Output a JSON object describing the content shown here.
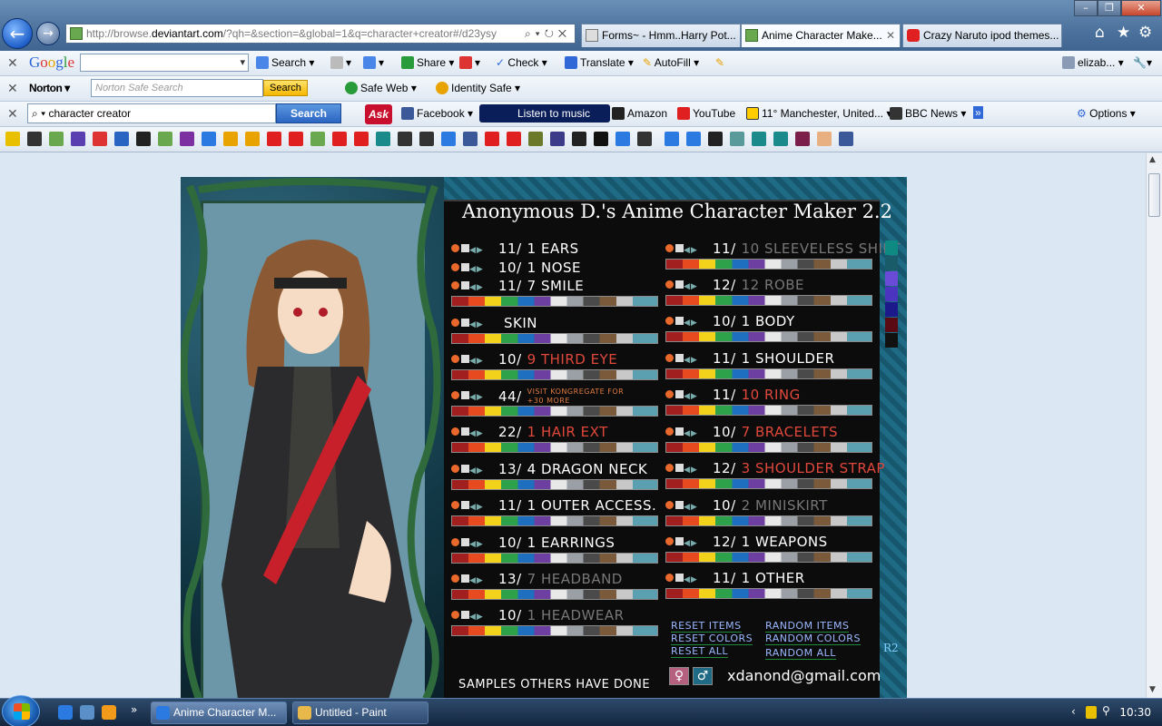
{
  "browser": {
    "url_prefix": "http://browse.",
    "url_domain": "deviantart.com",
    "url_rest": "/?qh=&section=&global=1&q=character+creator#/d23ysy",
    "tabs": [
      {
        "label": "Forms~ - Hmm..Harry Pot..."
      },
      {
        "label": "Anime Character Make..."
      },
      {
        "label": "Crazy Naruto ipod themes..."
      }
    ]
  },
  "google_toolbar": {
    "name": "Google",
    "search_label": "Search",
    "share_label": "Share",
    "check_label": "Check",
    "translate_label": "Translate",
    "autofill_label": "AutoFill",
    "user_label": "elizab..."
  },
  "norton_toolbar": {
    "name": "Norton",
    "search_placeholder": "Norton Safe Search",
    "search_button": "Search",
    "safe_web": "Safe Web",
    "identity_safe": "Identity Safe"
  },
  "ask_toolbar": {
    "query": "character creator",
    "search_button": "Search",
    "facebook": "Facebook",
    "music": "Listen to music",
    "amazon": "Amazon",
    "youtube": "YouTube",
    "weather": "11° Manchester, United...",
    "bbc": "BBC News",
    "options": "Options"
  },
  "game": {
    "title": "Anonymous D.'s Anime Character Maker 2.2",
    "left_rows": [
      {
        "count": "11/",
        "num": "1",
        "name": "EARS",
        "style": "white",
        "bar": false
      },
      {
        "count": "10/",
        "num": "1",
        "name": "NOSE",
        "style": "white",
        "bar": false
      },
      {
        "count": "11/",
        "num": "7",
        "name": "SMILE",
        "style": "white",
        "bar": true
      },
      {
        "count": "",
        "num": "",
        "name": "SKIN",
        "style": "white",
        "bar": true
      },
      {
        "count": "10/",
        "num": "9",
        "name": "THIRD EYE",
        "style": "red",
        "bar": true
      },
      {
        "count": "44/",
        "num": "",
        "name": "VISIT KONGREGATE FOR +30 MORE",
        "style": "promo",
        "bar": true
      },
      {
        "count": "22/",
        "num": "1",
        "name": "HAIR EXT",
        "style": "red",
        "bar": true
      },
      {
        "count": "13/",
        "num": "4",
        "name": "DRAGON NECK",
        "style": "white",
        "bar": true
      },
      {
        "count": "11/",
        "num": "1",
        "name": "OUTER ACCESS.",
        "style": "white",
        "bar": true
      },
      {
        "count": "10/",
        "num": "1",
        "name": "EARRINGS",
        "style": "white",
        "bar": true
      },
      {
        "count": "13/",
        "num": "7",
        "name": "HEADBAND",
        "style": "gray",
        "bar": true
      },
      {
        "count": "10/",
        "num": "1",
        "name": "HEADWEAR",
        "style": "gray",
        "bar": true
      }
    ],
    "right_rows": [
      {
        "count": "11/",
        "num": "10",
        "name": "SLEEVELESS SHIRT",
        "style": "gray",
        "bar": true
      },
      {
        "count": "12/",
        "num": "12",
        "name": "ROBE",
        "style": "gray",
        "bar": true
      },
      {
        "count": "10/",
        "num": "1",
        "name": "BODY",
        "style": "white",
        "bar": true
      },
      {
        "count": "11/",
        "num": "1",
        "name": "SHOULDER",
        "style": "white",
        "bar": true
      },
      {
        "count": "11/",
        "num": "10",
        "name": "RING",
        "style": "red",
        "bar": true
      },
      {
        "count": "10/",
        "num": "7",
        "name": "BRACELETS",
        "style": "red",
        "bar": true
      },
      {
        "count": "12/",
        "num": "3",
        "name": "SHOULDER STRAP",
        "style": "red",
        "bar": true
      },
      {
        "count": "10/",
        "num": "2",
        "name": "MINISKIRT",
        "style": "gray",
        "bar": true
      },
      {
        "count": "12/",
        "num": "1",
        "name": "WEAPONS",
        "style": "white",
        "bar": true
      },
      {
        "count": "11/",
        "num": "1",
        "name": "OTHER",
        "style": "white",
        "bar": true
      }
    ],
    "swatches": [
      "#0e8a82",
      "#1a5b6a",
      "#6a4bd8",
      "#4a34c0",
      "#1c1a8a",
      "#5a0a12",
      "#111111"
    ],
    "reset_items": "RESET ITEMS",
    "reset_colors": "RESET COLORS",
    "reset_all": "RESET ALL",
    "random_items": "RANDOM ITEMS",
    "random_colors": "RANDOM COLORS",
    "random_all": "RANDOM ALL",
    "r2": "R2",
    "samples": "SAMPLES OTHERS HAVE DONE",
    "female": "♀",
    "male": "♂",
    "email": "xdanond@gmail.com"
  },
  "taskbar": {
    "tasks": [
      {
        "label": "Anime Character M..."
      },
      {
        "label": "Untitled - Paint"
      }
    ],
    "clock": "10:30"
  }
}
